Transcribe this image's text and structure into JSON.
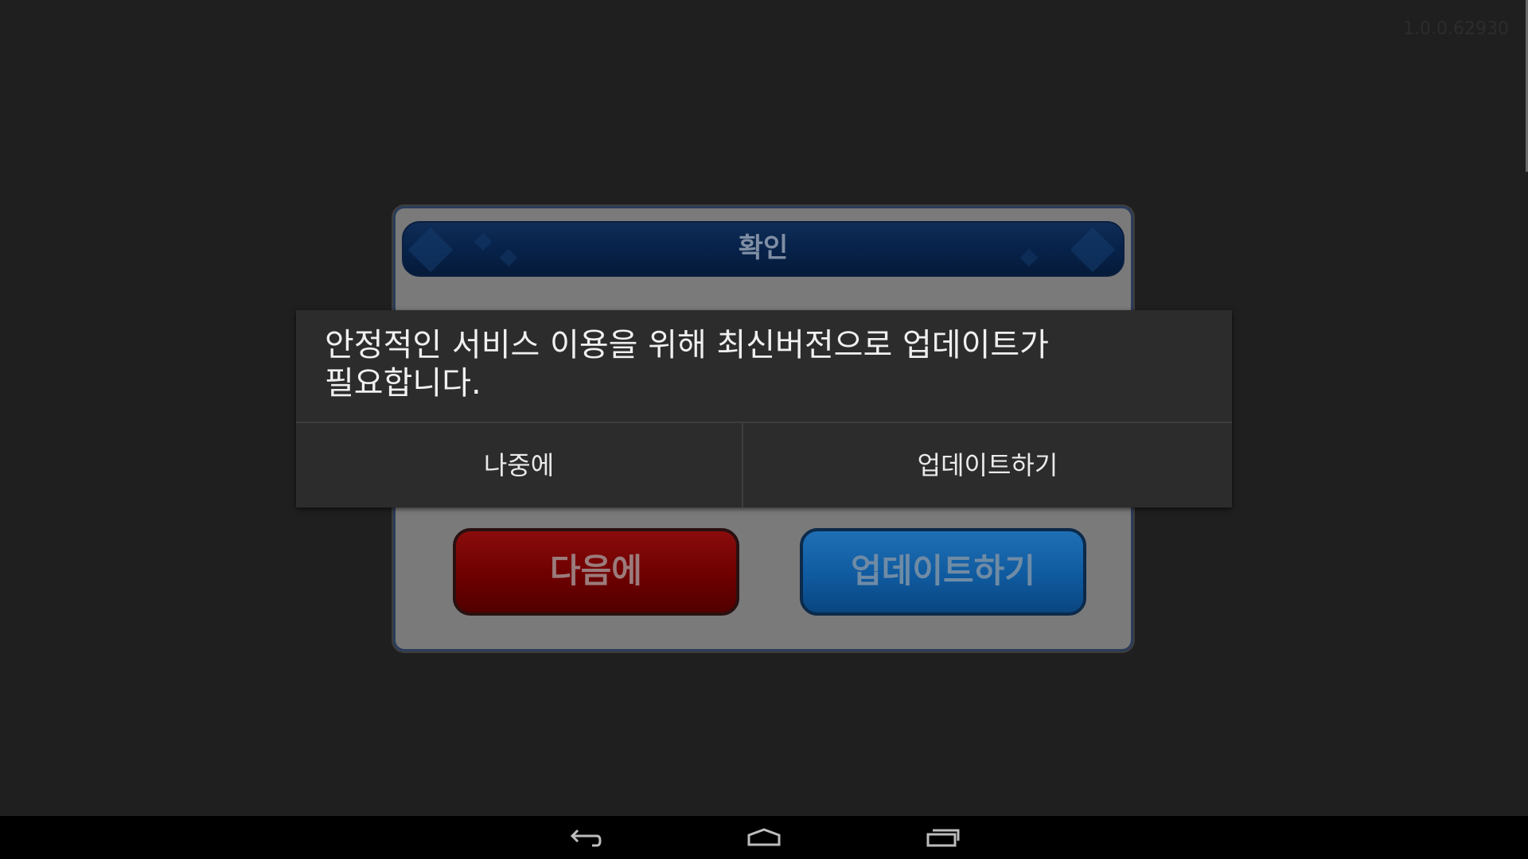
{
  "status": {
    "version": "1.0.0.62930"
  },
  "game_dialog": {
    "title": "확인",
    "later_button": "다음에",
    "update_button": "업데이트하기"
  },
  "alert": {
    "message": "안정적인 서비스 이용을 위해 최신버전으로 업데이트가\n필요합니다.",
    "negative_button": "나중에",
    "positive_button": "업데이트하기"
  },
  "navbar": {
    "icons": [
      "back-icon",
      "home-icon",
      "recent-apps-icon"
    ]
  },
  "colors": {
    "background": "#1f1f1f",
    "alert_bg": "#2c2c2c",
    "game_red": "#6e0000",
    "game_blue": "#0f5a9f",
    "game_header": "#07224a"
  }
}
